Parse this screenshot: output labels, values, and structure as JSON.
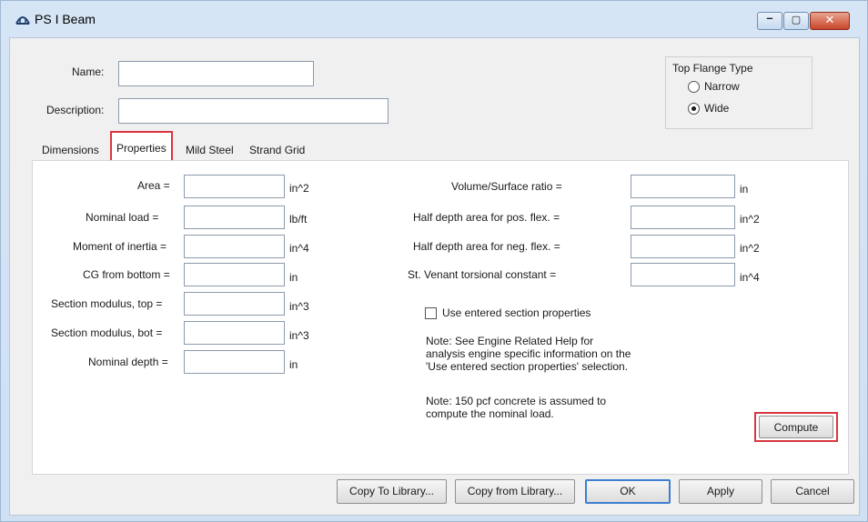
{
  "window": {
    "title": "PS I Beam",
    "minimize_icon": "minimize-icon",
    "maximize_icon": "maximize-icon",
    "close_icon": "close-icon"
  },
  "header": {
    "name_label": "Name:",
    "name_value": "",
    "description_label": "Description:",
    "description_value": ""
  },
  "top_flange": {
    "title": "Top Flange Type",
    "options": [
      {
        "label": "Narrow",
        "checked": false
      },
      {
        "label": "Wide",
        "checked": true
      }
    ]
  },
  "tabs": [
    {
      "label": "Dimensions",
      "active": false
    },
    {
      "label": "Properties",
      "active": true
    },
    {
      "label": "Mild Steel",
      "active": false
    },
    {
      "label": "Strand Grid",
      "active": false
    }
  ],
  "left_fields": [
    {
      "label": "Area =",
      "value": "",
      "unit": "in^2"
    },
    {
      "label": "Nominal load =",
      "value": "",
      "unit": "lb/ft"
    },
    {
      "label": "Moment of inertia =",
      "value": "",
      "unit": "in^4"
    },
    {
      "label": "CG from bottom =",
      "value": "",
      "unit": "in"
    },
    {
      "label": "Section modulus, top =",
      "value": "",
      "unit": "in^3"
    },
    {
      "label": "Section modulus, bot =",
      "value": "",
      "unit": "in^3"
    },
    {
      "label": "Nominal depth =",
      "value": "",
      "unit": "in"
    }
  ],
  "right_fields": [
    {
      "label": "Volume/Surface ratio =",
      "value": "",
      "unit": "in"
    },
    {
      "label": "Half depth area for pos. flex. =",
      "value": "",
      "unit": "in^2"
    },
    {
      "label": "Half depth area for neg. flex. =",
      "value": "",
      "unit": "in^2"
    },
    {
      "label": "St. Venant torsional constant =",
      "value": "",
      "unit": "in^4"
    }
  ],
  "use_entered": {
    "label": "Use entered section properties",
    "checked": false
  },
  "notes": {
    "note1_line1": "Note: See Engine Related Help for",
    "note1_line2": "analysis engine specific information on the",
    "note1_line3": "'Use entered section properties' selection.",
    "note2_line1": "Note: 150 pcf concrete is assumed to",
    "note2_line2": "compute the nominal load."
  },
  "buttons": {
    "compute": "Compute",
    "copy_to_library": "Copy To Library...",
    "copy_from_library": "Copy from Library...",
    "ok": "OK",
    "apply": "Apply",
    "cancel": "Cancel"
  },
  "colors": {
    "highlight": "#d9363e",
    "default_button_border": "#3c7fd0"
  }
}
